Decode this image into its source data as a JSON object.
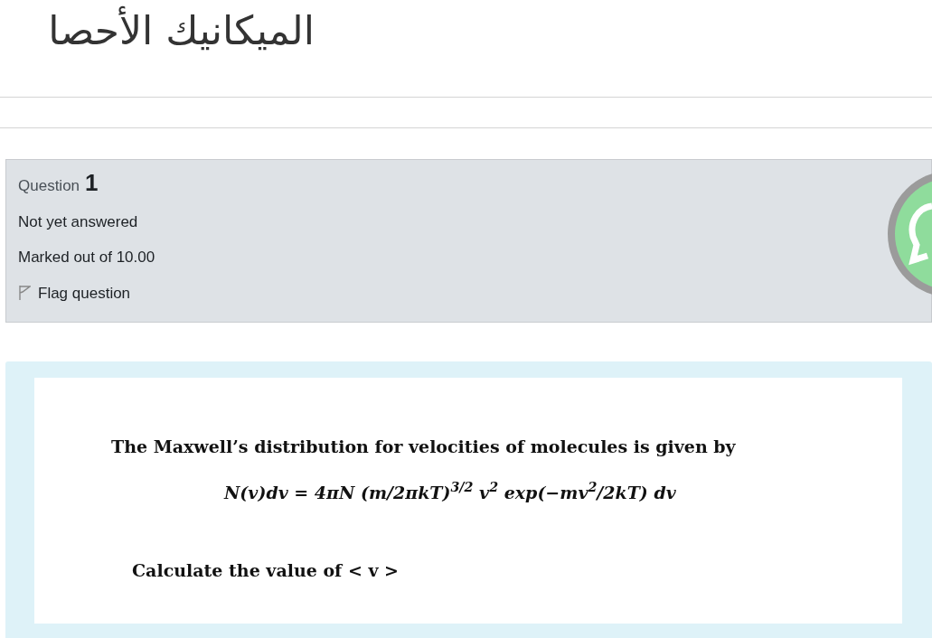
{
  "title": "الميكانيك الأحصا",
  "question": {
    "label": "Question",
    "number": "1",
    "status": "Not yet answered",
    "marks": "Marked out of 10.00",
    "flag": {
      "label": "Flag question",
      "flagged": false
    }
  },
  "content": {
    "intro": "The Maxwell’s distribution for velocities of molecules is given by",
    "formula": "N(v)dv = 4πN (m/2πkT)$^{3/2}$ v$^{2}$ exp(−mv$^{2}$/2kT) dv",
    "prompt": "Calculate the value of < v >"
  }
}
